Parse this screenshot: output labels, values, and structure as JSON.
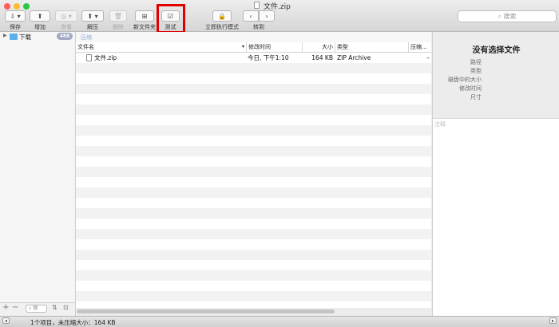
{
  "window": {
    "title": "文件.zip"
  },
  "toolbar": {
    "save": "保存",
    "add": "增加",
    "view": "查看",
    "extract": "解压",
    "delete": "删除",
    "new_folder": "新文件夹",
    "test": "测试",
    "run_now": "立即执行模式",
    "goto": "转到"
  },
  "search": {
    "placeholder": "搜索"
  },
  "sidebar": {
    "items": [
      {
        "label": "下载",
        "badge": "488",
        "icon": "folder-icon"
      }
    ],
    "search_placeholder": "搜"
  },
  "pathbar": {
    "label": "压缩"
  },
  "table": {
    "columns": [
      "文件名",
      "修改时间",
      "大小",
      "类型",
      "压缩..."
    ],
    "rows": [
      {
        "name": "文件.zip",
        "modified": "今日, 下午1:10",
        "size": "164 KB",
        "type": "ZIP Archive",
        "compressed": "–"
      }
    ]
  },
  "info": {
    "title": "没有选择文件",
    "fields": [
      "路径",
      "类型",
      "磁盘中的大小",
      "修改时间",
      "尺寸"
    ],
    "notes_placeholder": "注释"
  },
  "status": {
    "text": "1个项目，未压缩大小：164 KB"
  },
  "colors": {
    "highlight": "#e00000",
    "badge": "#9fa8c4",
    "folder": "#5ab0e8"
  }
}
